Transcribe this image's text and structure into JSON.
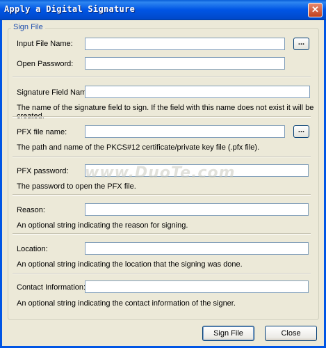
{
  "window": {
    "title": "Apply a Digital Signature",
    "close_glyph": "✕"
  },
  "group": {
    "label": "Sign File"
  },
  "fields": {
    "input_file": {
      "label": "Input File Name:",
      "value": "",
      "browse": "..."
    },
    "open_password": {
      "label": "Open Password:",
      "value": ""
    },
    "signature_field": {
      "label": "Signature Field Name:",
      "value": "",
      "description": "The name of the signature field to sign. If the field with this name does not exist it will be created."
    },
    "pfx_file": {
      "label": "PFX file name:",
      "value": "",
      "browse": "...",
      "description": "The path and name of the PKCS#12 certificate/private key file (.pfx file)."
    },
    "pfx_password": {
      "label": "PFX password:",
      "value": "",
      "description": "The password to open the PFX file."
    },
    "reason": {
      "label": "Reason:",
      "value": "",
      "description": "An optional string indicating the reason for signing."
    },
    "location": {
      "label": "Location:",
      "value": "",
      "description": "An optional string indicating the location that the signing was done."
    },
    "contact": {
      "label": "Contact Information:",
      "value": "",
      "description": "An optional string indicating the contact information of the signer."
    }
  },
  "buttons": {
    "sign_file": "Sign File",
    "close": "Close"
  },
  "watermark": "www.DuoTe.com",
  "colors": {
    "titlebar": "#0055E5",
    "face": "#ECE9D8",
    "group_label": "#1F4FAE"
  }
}
